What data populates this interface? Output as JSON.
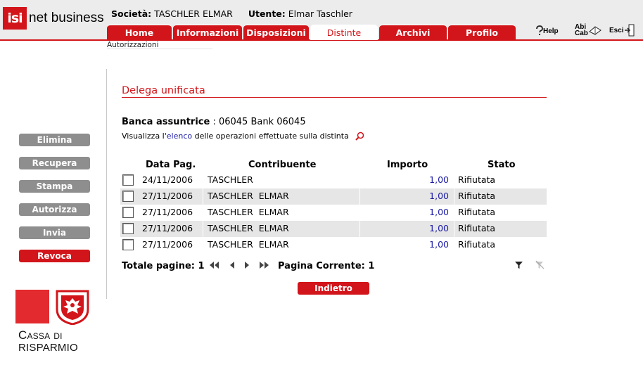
{
  "brand": {
    "logo_mark": "isi",
    "logo_text": "net business"
  },
  "header": {
    "company_label": "Società:",
    "company_value": "TASCHLER ELMAR",
    "user_label": "Utente:",
    "user_value": "Elmar Taschler"
  },
  "tabs": [
    {
      "label": "Home",
      "active": false
    },
    {
      "label": "Informazioni",
      "active": false
    },
    {
      "label": "Disposizioni",
      "active": false
    },
    {
      "label": "Distinte",
      "active": true
    },
    {
      "label": "Archivi",
      "active": false
    },
    {
      "label": "Profilo",
      "active": false
    }
  ],
  "utilities": {
    "help": "Help",
    "abicab_line1": "Abi",
    "abicab_line2": "Cab",
    "exit": "Esci"
  },
  "subnav": {
    "current": "Autorizzazioni"
  },
  "sidebar": {
    "buttons": [
      {
        "label": "Elimina",
        "color": "#8e8e8e"
      },
      {
        "label": "Recupera",
        "color": "#8e8e8e"
      },
      {
        "label": "Stampa",
        "color": "#8e8e8e"
      },
      {
        "label": "Autorizza",
        "color": "#8e8e8e"
      },
      {
        "label": "Invia",
        "color": "#8e8e8e"
      },
      {
        "label": "Revoca",
        "color": "#d2151a"
      }
    ]
  },
  "bank_logo": {
    "line1": "Cassa di",
    "line2": "Risparmio"
  },
  "main": {
    "title": "Delega unificata",
    "bank_label": "Banca assuntrice",
    "bank_value": "06045 Bank 06045",
    "view_prefix": "Visualizza l'",
    "view_link": "elenco",
    "view_suffix": "delle operazioni effettuate sulla distinta",
    "table": {
      "headers": {
        "date": "Data Pag.",
        "contributor": "Contribuente",
        "amount": "Importo",
        "status": "Stato"
      },
      "rows": [
        {
          "date": "24/11/2006",
          "contributor": "TASCHLER",
          "amount": "1,00",
          "status": "Rifiutata"
        },
        {
          "date": "27/11/2006",
          "contributor": "TASCHLER  ELMAR",
          "amount": "1,00",
          "status": "Rifiutata"
        },
        {
          "date": "27/11/2006",
          "contributor": "TASCHLER  ELMAR",
          "amount": "1,00",
          "status": "Rifiutata"
        },
        {
          "date": "27/11/2006",
          "contributor": "TASCHLER  ELMAR",
          "amount": "1,00",
          "status": "Rifiutata"
        },
        {
          "date": "27/11/2006",
          "contributor": "TASCHLER  ELMAR",
          "amount": "1,00",
          "status": "Rifiutata"
        }
      ]
    },
    "pager": {
      "total_label": "Totale pagine:",
      "total_value": "1",
      "current_label": "Pagina Corrente:",
      "current_value": "1"
    },
    "back_button": "Indietro"
  },
  "colors": {
    "brand_red": "#d2151a",
    "button_grey": "#8e8e8e",
    "link_blue": "#1a1aa8",
    "row_alt": "#e6e6e6"
  },
  "icons": [
    "isi-logo",
    "help-icon",
    "abicab-icon",
    "exit-icon",
    "search-icon",
    "first-page-icon",
    "prev-page-icon",
    "next-page-icon",
    "last-page-icon",
    "filter-icon",
    "clear-filter-icon",
    "crest-icon"
  ]
}
